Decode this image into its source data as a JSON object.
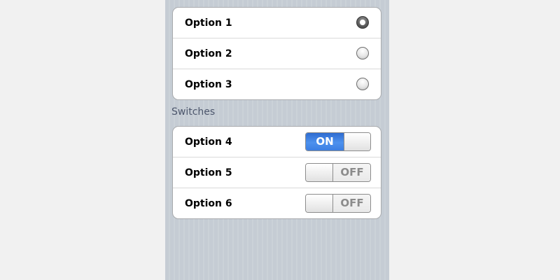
{
  "radio_group": {
    "options": [
      {
        "label": "Option 1",
        "checked": true
      },
      {
        "label": "Option 2",
        "checked": false
      },
      {
        "label": "Option 3",
        "checked": false
      }
    ]
  },
  "switches_section": {
    "header": "Switches",
    "items": [
      {
        "label": "Option 4",
        "state": "ON",
        "on": true
      },
      {
        "label": "Option 5",
        "state": "OFF",
        "on": false
      },
      {
        "label": "Option 6",
        "state": "OFF",
        "on": false
      }
    ]
  },
  "colors": {
    "switch_on": "#3b7ee2",
    "switch_off_text": "#8b8b8b",
    "background_stripes": "#c5ccd4",
    "section_header_text": "#4c566c"
  }
}
